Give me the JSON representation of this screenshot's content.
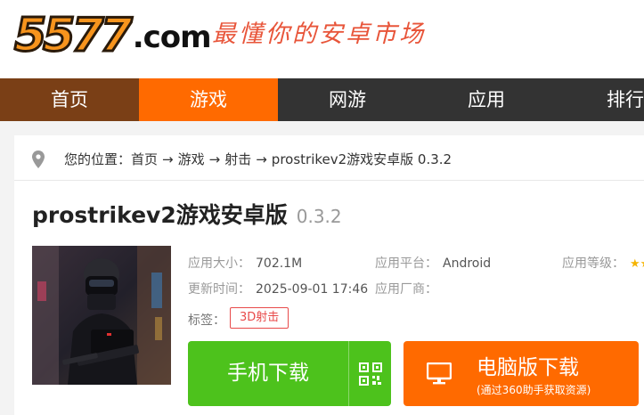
{
  "header": {
    "logo_digits": "5577",
    "logo_com": ".com",
    "slogan": "最懂你的安卓市场"
  },
  "nav": {
    "items": [
      {
        "label": "首页"
      },
      {
        "label": "游戏"
      },
      {
        "label": "网游"
      },
      {
        "label": "应用"
      },
      {
        "label": "排行"
      }
    ],
    "active": "游戏"
  },
  "breadcrumb": {
    "prefix": "您的位置：",
    "items": [
      "首页",
      "游戏",
      "射击",
      "prostrikev2游戏安卓版 0.3.2"
    ],
    "separator": "→"
  },
  "app": {
    "title": "prostrikev2游戏安卓版",
    "version": "0.3.2",
    "info": {
      "size_label": "应用大小：",
      "size_value": "702.1M",
      "platform_label": "应用平台：",
      "platform_value": "Android",
      "rating_label": "应用等级：",
      "rating_stars": "★★",
      "updated_label": "更新时间：",
      "updated_value": "2025-09-01 17:46",
      "vendor_label": "应用厂商：",
      "vendor_value": "",
      "tags_label": "标签：",
      "tags": [
        "3D射击"
      ]
    }
  },
  "buttons": {
    "mobile_download": "手机下载",
    "pc_download": "电脑版下载",
    "pc_download_sub": "(通过360助手获取资源)"
  },
  "colors": {
    "accent_orange": "#ff6a00",
    "nav_bg": "#333333",
    "nav_home": "#7a3f16",
    "green": "#4dc21c",
    "tag_red": "#e84a4a"
  }
}
